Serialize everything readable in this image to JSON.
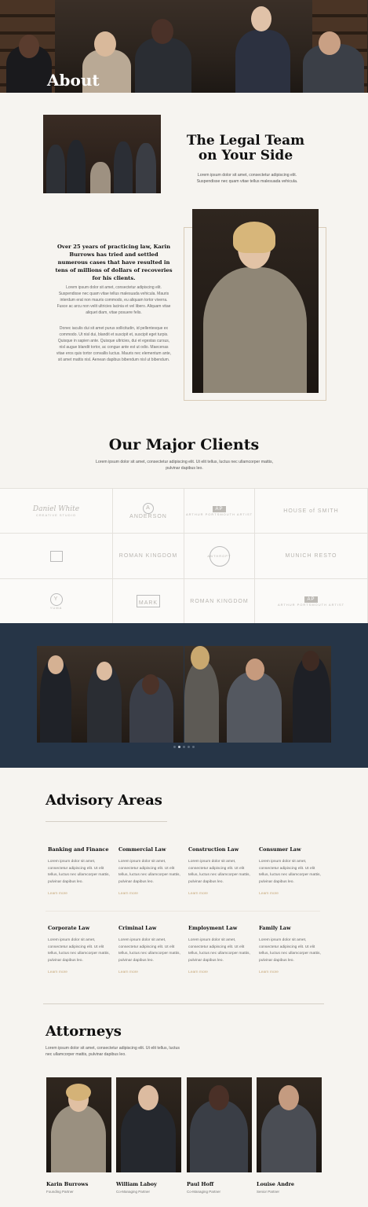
{
  "hero": {
    "title": "About"
  },
  "intro": {
    "title": "The Legal Team on Your Side",
    "text": "Lorem ipsum dolor sit amet, consectetur adipiscing elit. Suspendisse nec quam vitae tellus malesuada vehicula."
  },
  "karin": {
    "lead": "Over 25 years of practicing law, Karin Burrows has tried and settled numerous cases that have resulted in tens of millions of dollars of recoveries for his clients.",
    "p1": "Lorem ipsum dolor sit amet, consectetur adipiscing elit. Suspendisse nec quam vitae tellus malesuada vehicula. Mauris interdum erat non mauris commodo, eu aliquam tortor viverra. Fusce ac arcu non velit ultricies lacinia et vel libero. Aliquam vitae aliquet diam, vitae posuere felis.",
    "p2": "Donec iaculis dui sit amet purus sollicitudin, id pellentesque ex commodo. Ut nisl dui, blandit et suscipit et, suscipit eget turpis. Quisque in sapien ante. Quisque ultricies, dui et egestas cursus, nisl augue blandit tortor, ac congue ante est ut odio. Maecenas vitae eros quis tortor convallis luctus. Mauris nec elementum ante, sit amet mattis nisl. Aenean dapibus bibendum nisl ut bibendum."
  },
  "clients": {
    "title": "Our Major Clients",
    "text": "Lorem ipsum dolor sit amet, consectetur adipiscing elit. Ut elit tellus, luctus nec ullamcorper mattis, pulvinar dapibus leo.",
    "logos": [
      {
        "name": "Daniel White",
        "sub": "CREATIVE STUDIO"
      },
      {
        "name": "ANDERSON",
        "sub": "A"
      },
      {
        "name": "ARTHUR PORTSMOUTH ARTIST",
        "sub": "AP"
      },
      {
        "name": "HOUSE of SMITH",
        "sub": ""
      },
      {
        "name": "",
        "sub": ""
      },
      {
        "name": "ROMAN KINGDOM",
        "sub": ""
      },
      {
        "name": "ANTHROPY",
        "sub": ""
      },
      {
        "name": "MUNICH RESTO",
        "sub": ""
      },
      {
        "name": "YUMA",
        "sub": "Y"
      },
      {
        "name": "MARK",
        "sub": ""
      },
      {
        "name": "ROMAN KINGDOM",
        "sub": ""
      },
      {
        "name": "ARTHUR PORTSMOUTH ARTIST",
        "sub": "AP"
      }
    ]
  },
  "advisory": {
    "title": "Advisory Areas",
    "areas": [
      {
        "title": "Banking and Finance",
        "text": "Lorem ipsum dolor sit amet, consectetur adipiscing elit. Ut elit tellus, luctus nec ullamcorper mattis, pulvinar dapibus leo.",
        "link": "Learn more"
      },
      {
        "title": "Commercial Law",
        "text": "Lorem ipsum dolor sit amet, consectetur adipiscing elit. Ut elit tellus, luctus nec ullamcorper mattis, pulvinar dapibus leo.",
        "link": "Learn more"
      },
      {
        "title": "Construction Law",
        "text": "Lorem ipsum dolor sit amet, consectetur adipiscing elit. Ut elit tellus, luctus nec ullamcorper mattis, pulvinar dapibus leo.",
        "link": "Learn more"
      },
      {
        "title": "Consumer Law",
        "text": "Lorem ipsum dolor sit amet, consectetur adipiscing elit. Ut elit tellus, luctus nec ullamcorper mattis, pulvinar dapibus leo.",
        "link": "Learn more"
      },
      {
        "title": "Corporate Law",
        "text": "Lorem ipsum dolor sit amet, consectetur adipiscing elit. Ut elit tellus, luctus nec ullamcorper mattis, pulvinar dapibus leo.",
        "link": "Learn more"
      },
      {
        "title": "Criminal Law",
        "text": "Lorem ipsum dolor sit amet, consectetur adipiscing elit. Ut elit tellus, luctus nec ullamcorper mattis, pulvinar dapibus leo.",
        "link": "Learn more"
      },
      {
        "title": "Employment Law",
        "text": "Lorem ipsum dolor sit amet, consectetur adipiscing elit. Ut elit tellus, luctus nec ullamcorper mattis, pulvinar dapibus leo.",
        "link": "Learn more"
      },
      {
        "title": "Family Law",
        "text": "Lorem ipsum dolor sit amet, consectetur adipiscing elit. Ut elit tellus, luctus nec ullamcorper mattis, pulvinar dapibus leo.",
        "link": "Learn more"
      }
    ]
  },
  "attorneys": {
    "title": "Attorneys",
    "text": "Lorem ipsum dolor sit amet, consectetur adipiscing elit. Ut elit tellus, luctus nec ullamcorper mattis, pulvinar dapibus leo.",
    "people": [
      {
        "name": "Karin Burrows",
        "role": "Founding Partner"
      },
      {
        "name": "William Laboy",
        "role": "Co-Managing Partner"
      },
      {
        "name": "Paul Hoff",
        "role": "Co-Managing Partner"
      },
      {
        "name": "Louise Andre",
        "role": "Senior Partner"
      }
    ]
  },
  "slider": {
    "dots": 5,
    "active_index": 1
  },
  "colors": {
    "accent": "#c7a97c",
    "navy": "#263547",
    "background": "#f6f4f0"
  }
}
